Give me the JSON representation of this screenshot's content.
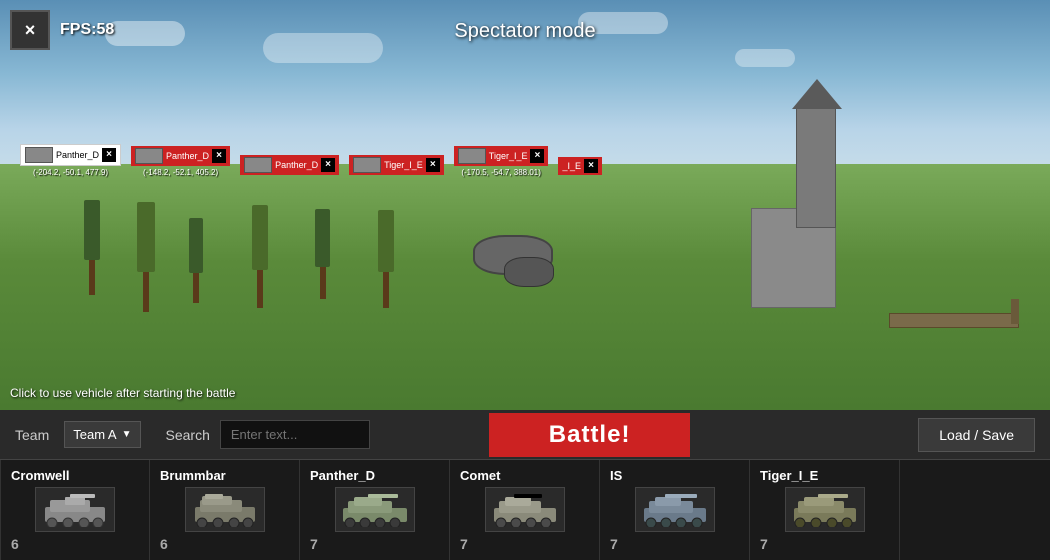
{
  "header": {
    "fps": "FPS:58",
    "spectator_mode": "Spectator mode",
    "close_icon": "×"
  },
  "viewport": {
    "click_hint": "Click to use vehicle after starting the battle"
  },
  "vehicle_markers": [
    {
      "name": "Panther_D",
      "coords": "(-204.2, -50.1, 477.9)",
      "style": "white"
    },
    {
      "name": "Panther_D",
      "coords": "(-148.2, -52.1, 405.2)",
      "style": "red"
    },
    {
      "name": "Panther_D",
      "coords": "",
      "style": "red"
    },
    {
      "name": "Tiger_I_E",
      "coords": "",
      "style": "red"
    },
    {
      "name": "Tiger_I_E",
      "coords": "(-170.5, -54.7, 388.01)",
      "style": "red"
    },
    {
      "name": "_I_E",
      "coords": "",
      "style": "red"
    }
  ],
  "controls": {
    "team_label": "Team",
    "team_value": "Team A",
    "search_label": "Search",
    "search_placeholder": "Enter text...",
    "battle_button": "Battle!",
    "load_save_button": "Load / Save"
  },
  "vehicles": [
    {
      "name": "Cromwell",
      "tier": "6"
    },
    {
      "name": "Brummbar",
      "tier": "6"
    },
    {
      "name": "Panther_D",
      "tier": "7"
    },
    {
      "name": "Comet",
      "tier": "7"
    },
    {
      "name": "IS",
      "tier": "7"
    },
    {
      "name": "Tiger_I_E",
      "tier": "7"
    }
  ],
  "scroll_offset": "0",
  "colors": {
    "red_marker": "#cc2222",
    "battle_btn": "#cc2222",
    "panel_bg": "#1a1a1a",
    "control_bg": "#2a2a2a"
  }
}
